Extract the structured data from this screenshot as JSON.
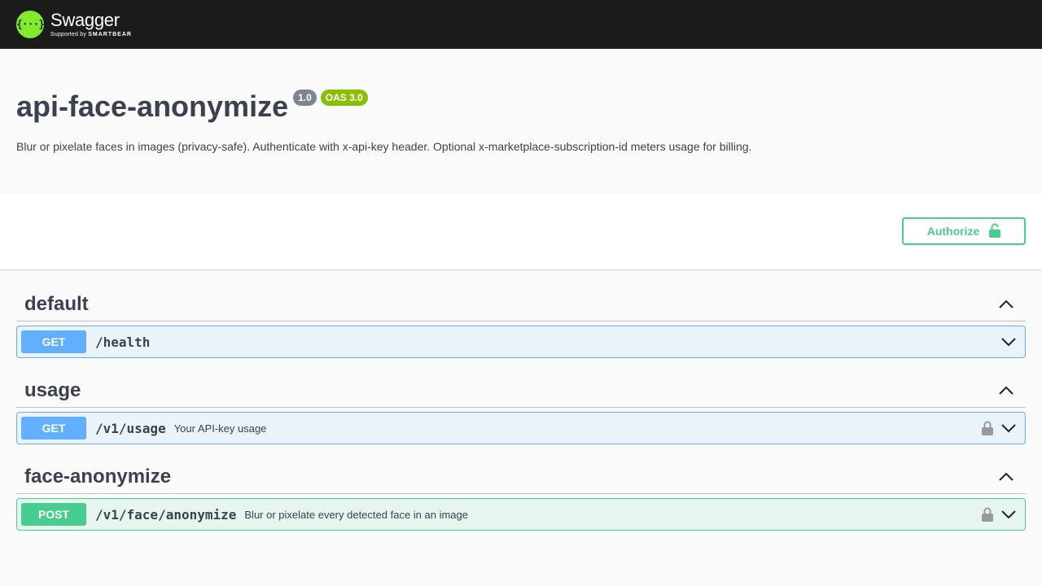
{
  "topbar": {
    "logo_symbol": "{···}",
    "logo_title": "Swagger",
    "logo_sub_prefix": "Supported by",
    "logo_sub_brand": "SMARTBEAR"
  },
  "info": {
    "title": "api-face-anonymize",
    "version_badge": "1.0",
    "oas_badge": "OAS 3.0",
    "description": "Blur or pixelate faces in images (privacy-safe). Authenticate with x-api-key header. Optional x-marketplace-subscription-id meters usage for billing."
  },
  "authorize": {
    "label": "Authorize",
    "icon": "unlocked-lock-icon"
  },
  "tags": [
    {
      "name": "default",
      "operations": [
        {
          "method": "GET",
          "path": "/health",
          "summary": "",
          "locked": false
        }
      ]
    },
    {
      "name": "usage",
      "operations": [
        {
          "method": "GET",
          "path": "/v1/usage",
          "summary": "Your API-key usage",
          "locked": true
        }
      ]
    },
    {
      "name": "face-anonymize",
      "operations": [
        {
          "method": "POST",
          "path": "/v1/face/anonymize",
          "summary": "Blur or pixelate every detected face in an image",
          "locked": true
        }
      ]
    }
  ],
  "colors": {
    "get": "#61affe",
    "post": "#49cc90",
    "topbar": "#1b1b1b",
    "logo": "#85ea2d"
  }
}
